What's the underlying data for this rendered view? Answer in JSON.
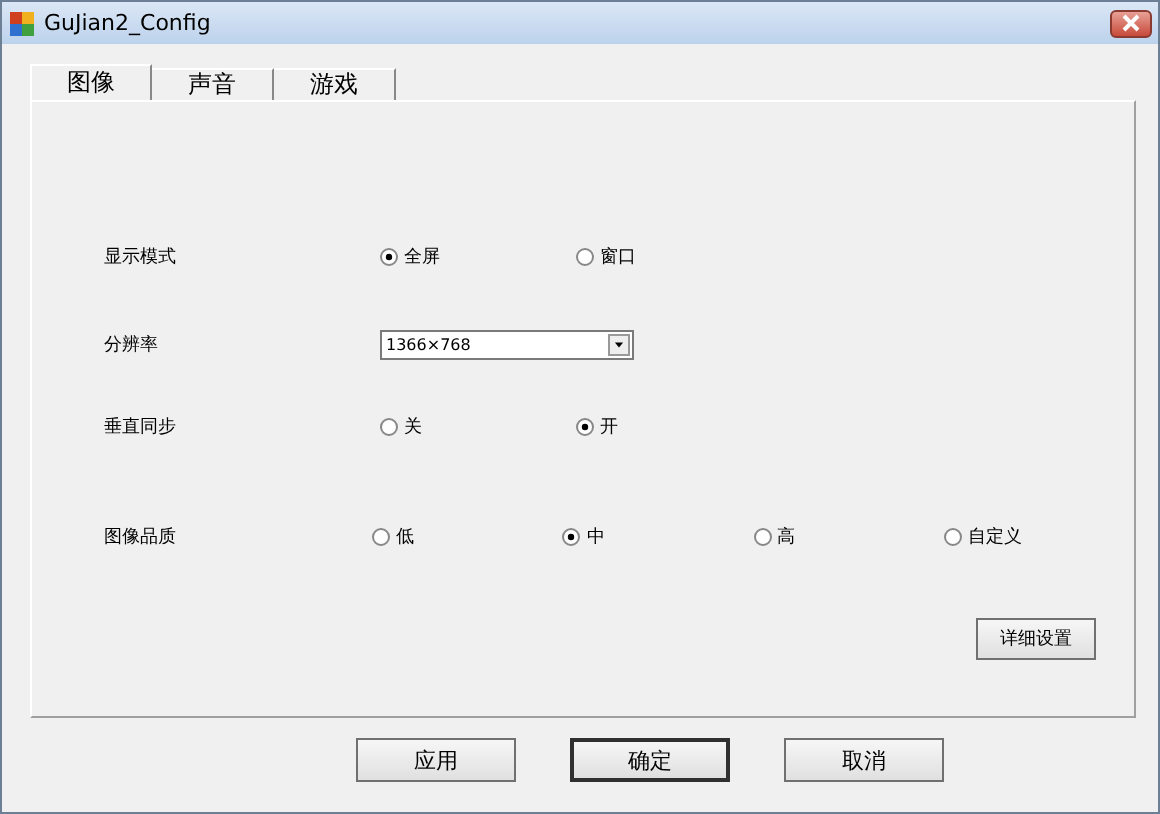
{
  "window": {
    "title": "GuJian2_Config"
  },
  "tabs": [
    {
      "label": "图像",
      "selected": true
    },
    {
      "label": "声音",
      "selected": false
    },
    {
      "label": "游戏",
      "selected": false
    }
  ],
  "settings": [
    {
      "kind": "radio",
      "label": "显示模式",
      "options": [
        {
          "label": "全屏",
          "selected": true
        },
        {
          "label": "窗口",
          "selected": false
        }
      ]
    },
    {
      "kind": "dropdown",
      "label": "分辨率",
      "value": "1366×768"
    },
    {
      "kind": "radio",
      "label": "垂直同步",
      "options": [
        {
          "label": "关",
          "selected": false
        },
        {
          "label": "开",
          "selected": true
        }
      ]
    },
    {
      "kind": "radio",
      "label": "图像品质",
      "options": [
        {
          "label": "低",
          "selected": false
        },
        {
          "label": "中",
          "selected": true
        },
        {
          "label": "高",
          "selected": false
        },
        {
          "label": "自定义",
          "selected": false
        }
      ]
    }
  ],
  "detail_button": "详细设置",
  "buttons": [
    {
      "label": "应用",
      "selected": false
    },
    {
      "label": "确定",
      "selected": true
    },
    {
      "label": "取消",
      "selected": false
    }
  ]
}
